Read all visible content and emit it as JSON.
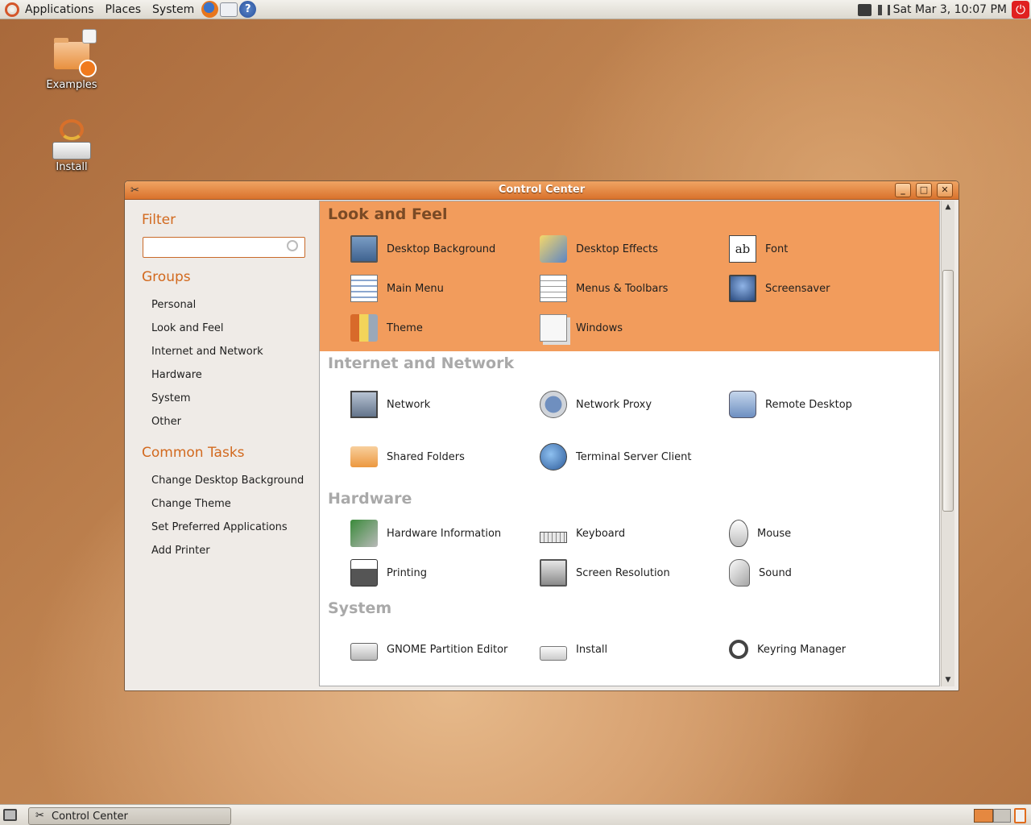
{
  "top_panel": {
    "menus": [
      "Applications",
      "Places",
      "System"
    ],
    "clock": "Sat Mar  3, 10:07 PM",
    "launcher_icons": [
      "firefox-icon",
      "mail-icon",
      "help-icon"
    ]
  },
  "desktop": {
    "icons": [
      {
        "label": "Examples",
        "icon": "folder-icon"
      },
      {
        "label": "Install",
        "icon": "install-icon"
      }
    ]
  },
  "window": {
    "title": "Control Center"
  },
  "sidebar": {
    "filter_heading": "Filter",
    "search_value": "",
    "groups_heading": "Groups",
    "groups": [
      "Personal",
      "Look and Feel",
      "Internet and Network",
      "Hardware",
      "System",
      "Other"
    ],
    "tasks_heading": "Common Tasks",
    "tasks": [
      "Change Desktop Background",
      "Change Theme",
      "Set Preferred Applications",
      "Add Printer"
    ]
  },
  "content": {
    "sections": [
      {
        "title": "Look and Feel",
        "items": [
          "Desktop Background",
          "Desktop Effects",
          "Font",
          "Main Menu",
          "Menus & Toolbars",
          "Screensaver",
          "Theme",
          "Windows"
        ]
      },
      {
        "title": "Internet and Network",
        "items": [
          "Network",
          "Network Proxy",
          "Remote Desktop",
          "Shared Folders",
          "Terminal Server Client"
        ]
      },
      {
        "title": "Hardware",
        "items": [
          "Hardware Information",
          "Keyboard",
          "Mouse",
          "Printing",
          "Screen Resolution",
          "Sound"
        ]
      },
      {
        "title": "System",
        "items": [
          "GNOME Partition Editor",
          "Install",
          "Keyring Manager"
        ]
      }
    ]
  },
  "taskbar": {
    "tasks": [
      "Control Center"
    ]
  },
  "colors": {
    "accent": "#d2691e",
    "selected_section_bg": "#f29c5c"
  }
}
